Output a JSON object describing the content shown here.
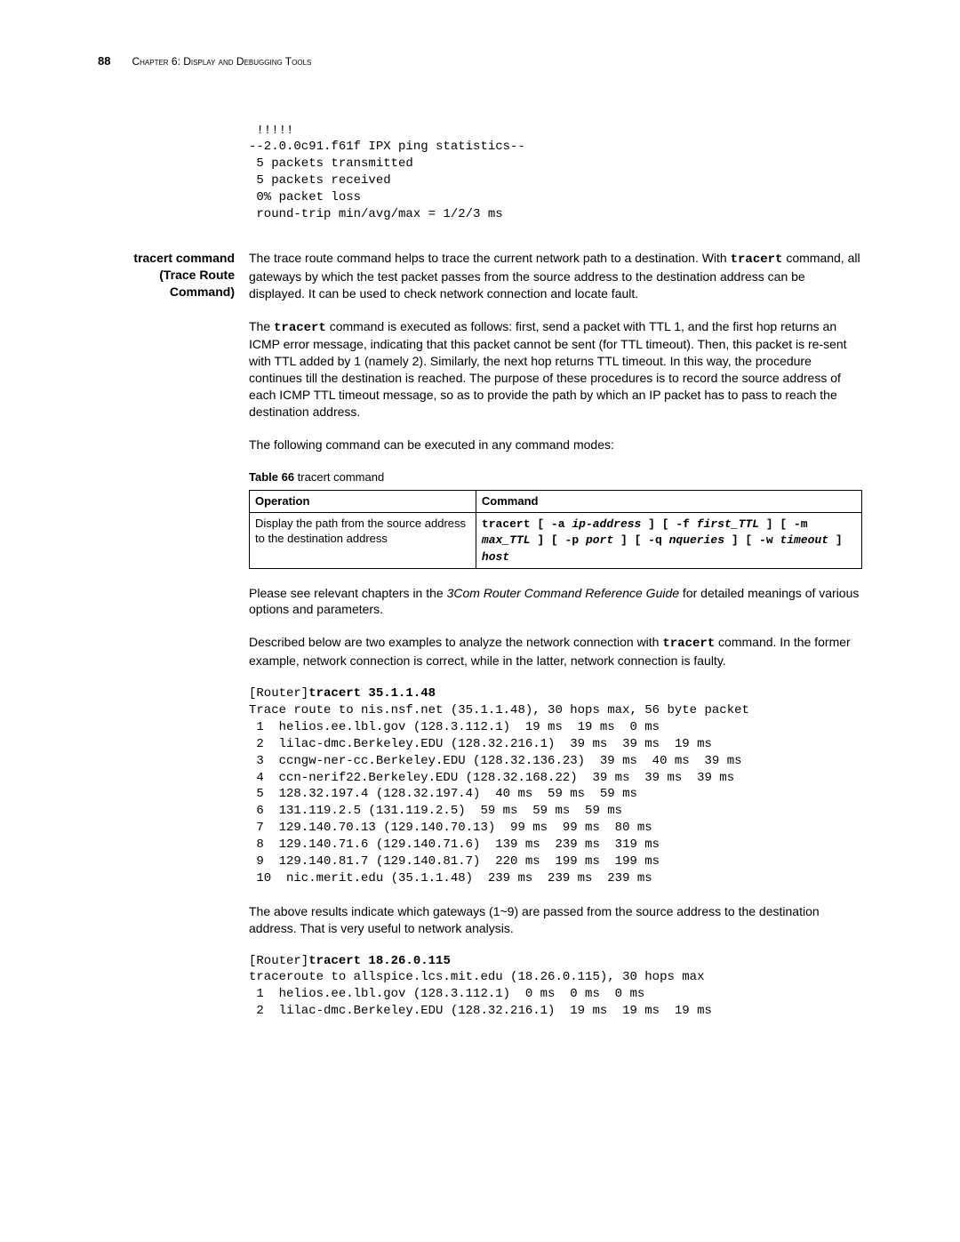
{
  "header": {
    "page_number": "88",
    "chapter": "Chapter 6: Display and Debugging Tools"
  },
  "topblock": " !!!!!\n--2.0.0c91.f61f IPX ping statistics--\n 5 packets transmitted\n 5 packets received\n 0% packet loss\n round-trip min/avg/max = 1/2/3 ms",
  "sideheading": "tracert command (Trace Route Command)",
  "para1_a": "The trace route command helps to trace the current network path to a destination. With ",
  "para1_cmd": "tracert",
  "para1_b": " command, all gateways by which the test packet passes from the source address to the destination address can be displayed. It can be used to check network connection and locate fault.",
  "para2_a": "The ",
  "para2_cmd": "tracert",
  "para2_b": " command is executed as follows: first, send a packet with TTL 1, and the first hop returns an ICMP error message, indicating that this packet cannot be sent (for TTL timeout). Then, this packet is re-sent with TTL added by 1 (namely 2). Similarly, the next hop returns TTL timeout. In this way, the procedure continues till the destination is reached. The purpose of these procedures is to record the source address of each ICMP TTL timeout message, so as to provide the path by which an IP packet has to pass to reach the destination address.",
  "para3": "The following command can be executed in any command modes:",
  "table": {
    "caption_bold": "Table 66",
    "caption_rest": "   tracert command",
    "head_op": "Operation",
    "head_cmd": "Command",
    "row_op": "Display the path from the source address to the destination address",
    "cmd_plain1": "tracert [ -a ",
    "cmd_it1": "ip-address",
    "cmd_plain2": " ] [ -f ",
    "cmd_it2": "first_TTL",
    "cmd_plain3": " ] [ -m ",
    "cmd_it3": "max_TTL",
    "cmd_plain4": " ] [ -p ",
    "cmd_it4": "port",
    "cmd_plain5": " ] [ -q ",
    "cmd_it5": "nqueries",
    "cmd_plain6": " ] [ -w ",
    "cmd_it6": "timeout",
    "cmd_plain7": "  ] ",
    "cmd_it7": "host"
  },
  "para4_a": "Please see relevant chapters in the ",
  "para4_it": "3Com Router Command Reference Guide",
  "para4_b": " for detailed meanings of various options and parameters.",
  "para5_a": "Described below are two examples to analyze the network connection with ",
  "para5_cmd": "tracert",
  "para5_b": " command. In the former example, network connection is correct, while in the latter, network connection is faulty.",
  "ex1_prompt": "[Router]",
  "ex1_cmd": "tracert 35.1.1.48",
  "ex1_body": "Trace route to nis.nsf.net (35.1.1.48), 30 hops max, 56 byte packet\n 1  helios.ee.lbl.gov (128.3.112.1)  19 ms  19 ms  0 ms\n 2  lilac-dmc.Berkeley.EDU (128.32.216.1)  39 ms  39 ms  19 ms\n 3  ccngw-ner-cc.Berkeley.EDU (128.32.136.23)  39 ms  40 ms  39 ms\n 4  ccn-nerif22.Berkeley.EDU (128.32.168.22)  39 ms  39 ms  39 ms\n 5  128.32.197.4 (128.32.197.4)  40 ms  59 ms  59 ms\n 6  131.119.2.5 (131.119.2.5)  59 ms  59 ms  59 ms\n 7  129.140.70.13 (129.140.70.13)  99 ms  99 ms  80 ms\n 8  129.140.71.6 (129.140.71.6)  139 ms  239 ms  319 ms\n 9  129.140.81.7 (129.140.81.7)  220 ms  199 ms  199 ms\n 10  nic.merit.edu (35.1.1.48)  239 ms  239 ms  239 ms",
  "para6": "The above results indicate which gateways (1~9) are passed from the source address to the destination address. That is very useful to network analysis.",
  "ex2_prompt": "[Router]",
  "ex2_cmd": "tracert 18.26.0.115",
  "ex2_body": "traceroute to allspice.lcs.mit.edu (18.26.0.115), 30 hops max\n 1  helios.ee.lbl.gov (128.3.112.1)  0 ms  0 ms  0 ms\n 2  lilac-dmc.Berkeley.EDU (128.32.216.1)  19 ms  19 ms  19 ms"
}
